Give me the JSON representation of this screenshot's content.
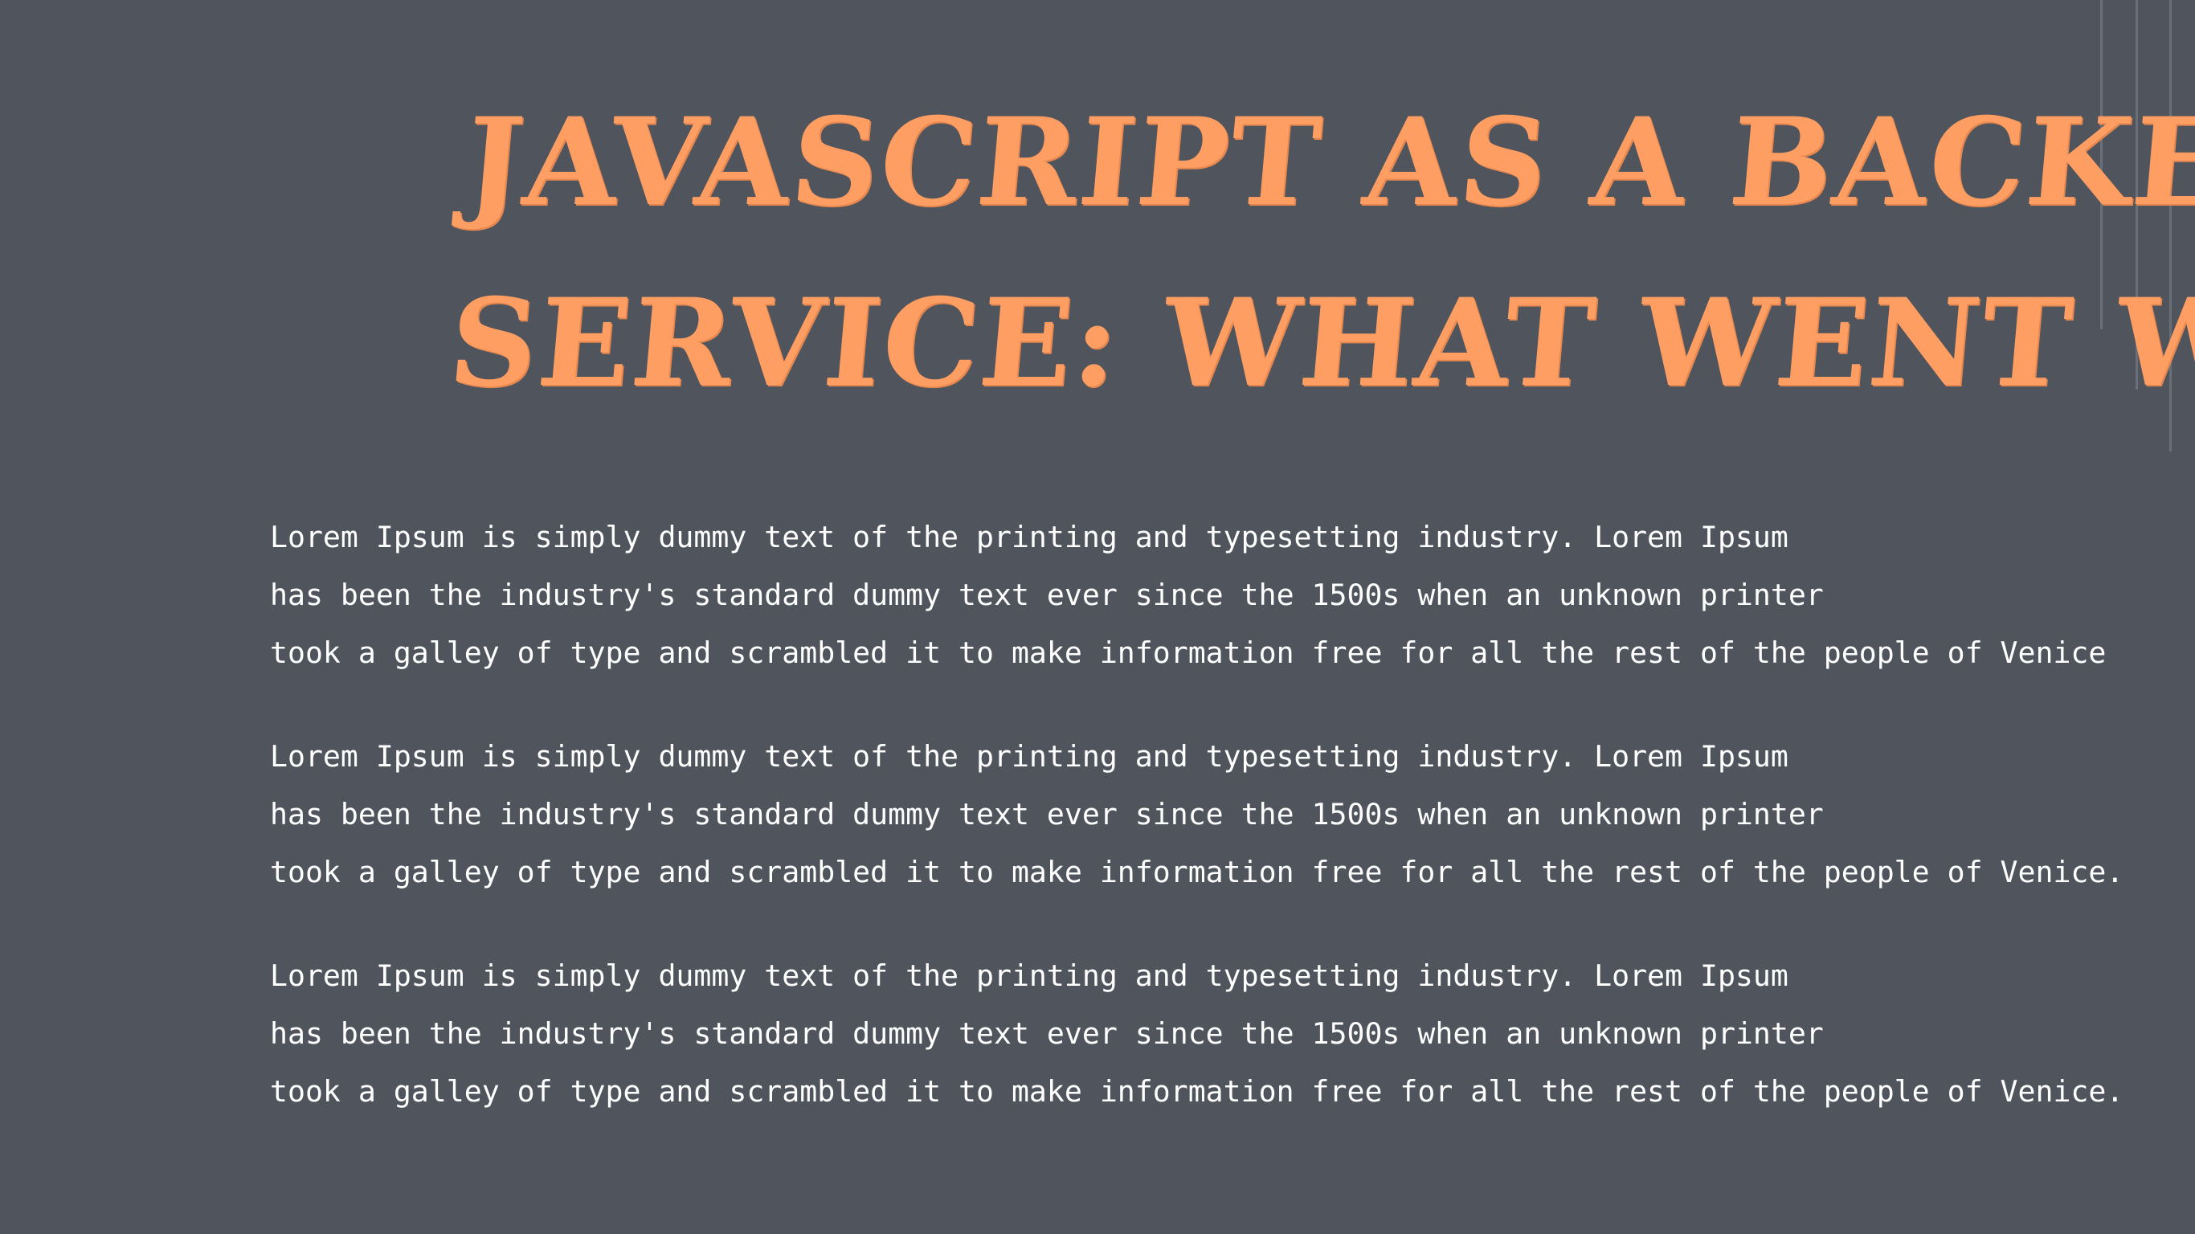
{
  "slide": {
    "background": "#50555d",
    "accent": "#ff9e62",
    "text_color": "#ffffff",
    "title_lines": [
      "JavaScript as a Backend",
      "Service: What went wrong"
    ],
    "paragraphs": [
      {
        "lines": [
          "Lorem Ipsum is simply dummy text of the printing and typesetting industry. Lorem Ipsum",
          "has been the industry's standard dummy text ever since the 1500s when an unknown printer",
          "took a galley of type and scrambled it to make information free for all the rest of the people of Venice"
        ]
      },
      {
        "lines": [
          "Lorem Ipsum is simply dummy text of the printing and typesetting industry. Lorem Ipsum",
          "has been the industry's standard dummy text ever since the 1500s when an unknown printer",
          "took a galley of type and scrambled it to make information free for all the rest of the people of Venice."
        ]
      },
      {
        "lines": [
          "Lorem Ipsum is simply dummy text of the printing and typesetting industry. Lorem Ipsum",
          "has been the industry's standard dummy text ever since the 1500s when an unknown printer",
          "took a galley of type and scrambled it to make information free for all the rest of the people of Venice."
        ]
      }
    ]
  }
}
